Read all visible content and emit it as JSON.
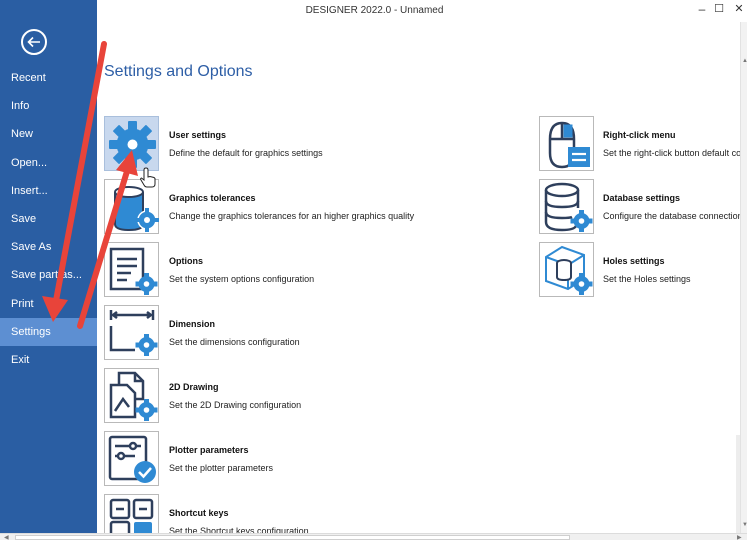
{
  "window": {
    "title": "DESIGNER 2022.0 - Unnamed",
    "minimize": "–",
    "maximize": "☐",
    "close": "✕"
  },
  "sidebar": {
    "items": [
      {
        "label": "Recent"
      },
      {
        "label": "Info"
      },
      {
        "label": "New"
      },
      {
        "label": "Open..."
      },
      {
        "label": "Insert..."
      },
      {
        "label": "Save"
      },
      {
        "label": "Save As"
      },
      {
        "label": "Save part as..."
      },
      {
        "label": "Print"
      },
      {
        "label": "Settings",
        "active": true
      },
      {
        "label": "Exit"
      }
    ]
  },
  "main": {
    "heading": "Settings and Options",
    "left_entries": [
      {
        "title": "User settings",
        "desc": "Define the default for graphics settings",
        "icon": "gear-icon"
      },
      {
        "title": "Graphics tolerances",
        "desc": "Change the graphics tolerances for an higher graphics quality",
        "icon": "graphics-tolerance-icon"
      },
      {
        "title": "Options",
        "desc": "Set the system options configuration",
        "icon": "options-list-icon"
      },
      {
        "title": "Dimension",
        "desc": "Set the dimensions configuration",
        "icon": "dimension-icon"
      },
      {
        "title": "2D Drawing",
        "desc": "Set the 2D Drawing configuration",
        "icon": "drawing-2d-icon"
      },
      {
        "title": "Plotter parameters",
        "desc": "Set the plotter parameters",
        "icon": "plotter-icon"
      },
      {
        "title": "Shortcut keys",
        "desc": "Set the Shortcut keys configuration",
        "icon": "shortcut-keys-icon"
      }
    ],
    "right_entries": [
      {
        "title": "Right-click menu",
        "desc": "Set the right-click button default cor",
        "icon": "mouse-icon"
      },
      {
        "title": "Database settings",
        "desc": "Configure the database connection s",
        "icon": "database-icon"
      },
      {
        "title": "Holes settings",
        "desc": "Set the Holes settings",
        "icon": "holes-icon"
      }
    ]
  },
  "colors": {
    "sidebar_bg": "#2a5ea3",
    "sidebar_active": "#5d8fd2",
    "heading": "#2d5ea6",
    "icon_navy": "#2e3f5c",
    "icon_blue": "#2f8ad3",
    "annotation_red": "#e8443a"
  }
}
